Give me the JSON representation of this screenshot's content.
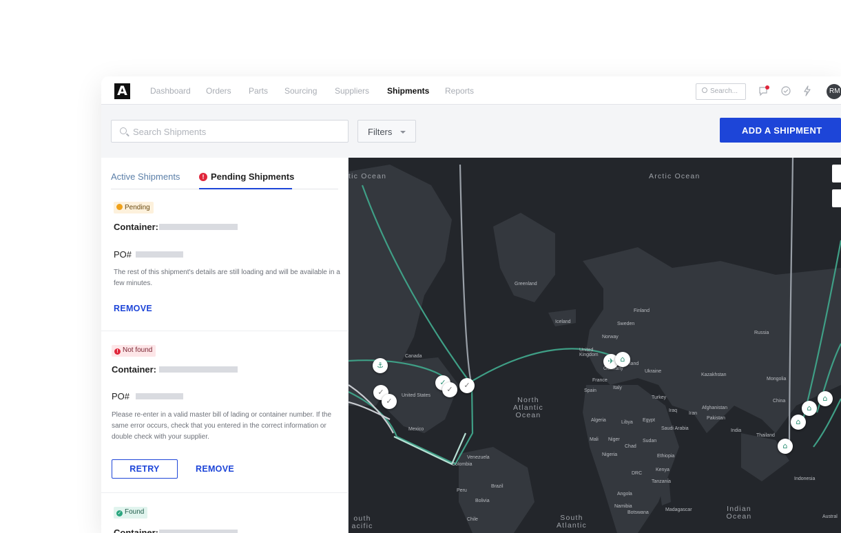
{
  "nav": {
    "logo": "A",
    "links": [
      "Dashboard",
      "Orders",
      "Parts",
      "Sourcing",
      "Suppliers",
      "Shipments",
      "Reports"
    ],
    "active_link": "Shipments",
    "search_placeholder": "Search...",
    "avatar_initials": "RM"
  },
  "toolbar": {
    "search_placeholder": "Search Shipments",
    "filters_label": "Filters",
    "add_button": "ADD A SHIPMENT"
  },
  "tabs": {
    "active_shipments": "Active Shipments",
    "pending_shipments": "Pending Shipments"
  },
  "cards": [
    {
      "status": "Pending",
      "container_label": "Container:",
      "po_label": "PO#",
      "message": "The rest of this shipment's details are still loading and will be available in a few minutes.",
      "remove_label": "REMOVE"
    },
    {
      "status": "Not found",
      "container_label": "Container:",
      "po_label": "PO#",
      "message": "Please re-enter in a valid master bill of lading or container number. If the same error occurs, check that you entered in the correct information or double check with your supplier.",
      "retry_label": "RETRY",
      "remove_label": "REMOVE"
    },
    {
      "status": "Found",
      "container_label": "Container:"
    }
  ],
  "map": {
    "oceans": {
      "arctic_left": "tic Ocean",
      "arctic": "Arctic Ocean",
      "north_atlantic": "North Atlantic Ocean",
      "south_atlantic": "South Atlantic",
      "south_pacific": "outh acific",
      "indian": "Indian Ocean"
    },
    "places": {
      "greenland": "Greenland",
      "iceland": "Iceland",
      "finland": "Finland",
      "sweden": "Sweden",
      "norway": "Norway",
      "russia": "Russia",
      "uk": "United Kingdom",
      "germany": "Germany",
      "poland": "land",
      "ukraine": "Ukraine",
      "kazakhstan": "Kazakhstan",
      "mongolia": "Mongolia",
      "france": "France",
      "spain": "Spain",
      "italy": "Italy",
      "turkey": "Turkey",
      "china": "China",
      "canada": "Canada",
      "us": "United States",
      "mexico": "Mexico",
      "iraq": "Iraq",
      "iran": "Iran",
      "afghanistan": "Afghanistan",
      "pakistan": "Pakistan",
      "algeria": "Algeria",
      "libya": "Libya",
      "egypt": "Egypt",
      "saudi": "Saudi Arabia",
      "india": "India",
      "thailand": "Thailand",
      "mali": "Mali",
      "niger": "Niger",
      "sudan": "Sudan",
      "chad": "Chad",
      "nigeria": "Nigeria",
      "ethiopia": "Ethiopia",
      "venezuela": "Venezuela",
      "colombia": "Colombia",
      "drc": "DRC",
      "kenya": "Kenya",
      "tanzania": "Tanzania",
      "indonesia": "Indonesia",
      "peru": "Peru",
      "brazil": "Brazil",
      "bolivia": "Bolivia",
      "angola": "Angola",
      "namibia": "Namibia",
      "botswana": "Botswana",
      "madagascar": "Madagascar",
      "chile": "Chile",
      "australia": "Austral"
    }
  },
  "colors": {
    "brand_blue": "#1d45d8",
    "route_teal": "#3f9f86",
    "map_bg": "#23262b"
  }
}
